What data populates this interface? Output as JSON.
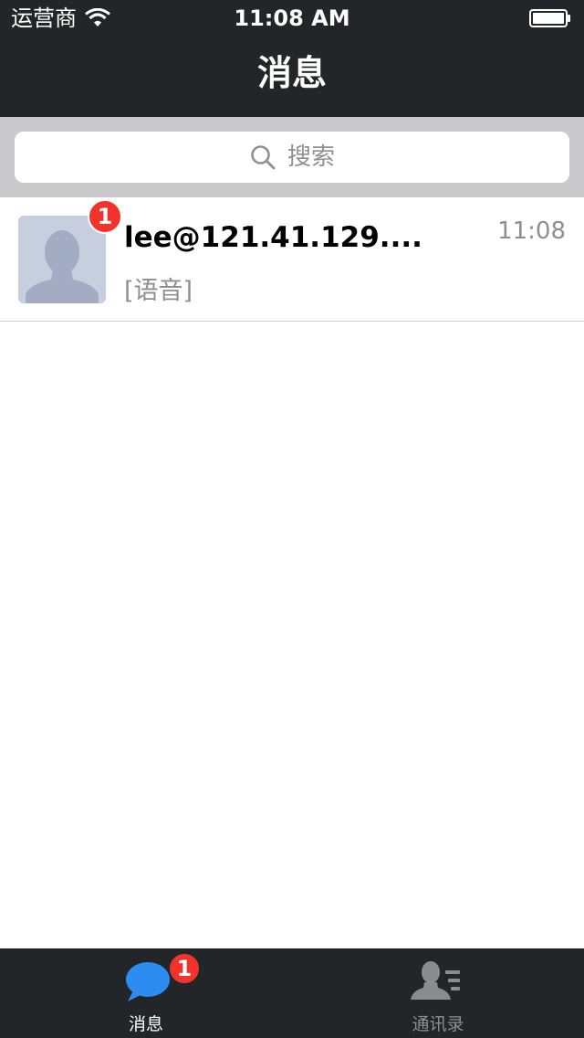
{
  "status_bar": {
    "carrier": "运营商",
    "time": "11:08 AM",
    "wifi_icon": "wifi-icon",
    "battery_icon": "battery-icon"
  },
  "nav": {
    "title": "消息"
  },
  "search": {
    "placeholder": "搜索",
    "icon": "search-icon"
  },
  "conversations": [
    {
      "name": "lee@121.41.129....",
      "last_message": "[语音]",
      "time": "11:08",
      "unread": "1",
      "avatar_icon": "default-avatar-icon"
    }
  ],
  "tabbar": {
    "tabs": [
      {
        "label": "消息",
        "icon": "chat-bubble-icon",
        "badge": "1",
        "active": true
      },
      {
        "label": "通讯录",
        "icon": "contacts-icon",
        "active": false
      }
    ]
  },
  "colors": {
    "bar_bg": "#232628",
    "search_area_bg": "#c9c9ce",
    "badge_red": "#f2332b",
    "accent_blue": "#2d8cf0",
    "secondary_text": "#8e8e93"
  }
}
